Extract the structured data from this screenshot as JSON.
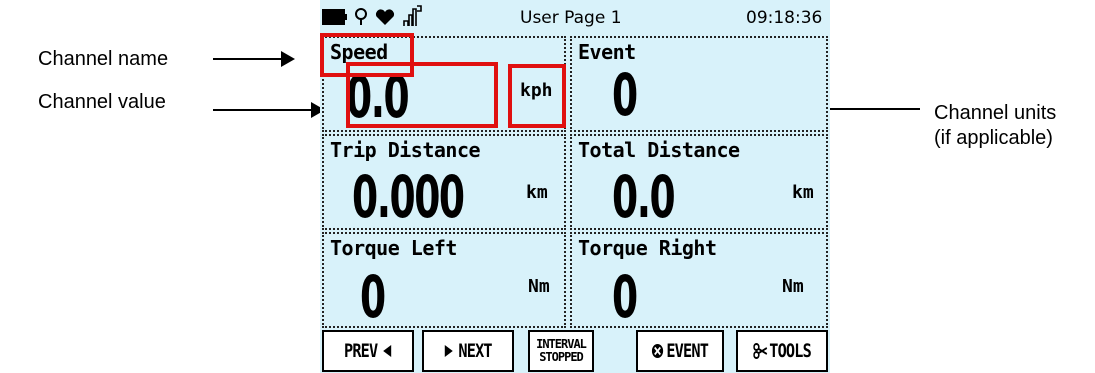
{
  "annotations": {
    "channel_name": "Channel name",
    "channel_value": "Channel value",
    "channel_units_line1": "Channel units",
    "channel_units_line2": "(if applicable)"
  },
  "status_bar": {
    "icons": [
      "battery-icon",
      "location-pin-icon",
      "heart-icon",
      "signal-icon"
    ],
    "page_title": "User Page 1",
    "time": "09:18:36"
  },
  "tiles": [
    {
      "name": "Speed",
      "value": "0.0",
      "unit": "kph"
    },
    {
      "name": "Event",
      "value": "0",
      "unit": ""
    },
    {
      "name": "Trip Distance",
      "value": "0.000",
      "unit": "km"
    },
    {
      "name": "Total Distance",
      "value": "0.0",
      "unit": "km"
    },
    {
      "name": "Torque Left",
      "value": "0",
      "unit": "Nm"
    },
    {
      "name": "Torque Right",
      "value": "0",
      "unit": "Nm"
    }
  ],
  "softkeys": {
    "prev": "PREV",
    "next": "NEXT",
    "interval_line1": "INTERVAL",
    "interval_line2": "STOPPED",
    "event": "EVENT",
    "tools": "TOOLS"
  },
  "colors": {
    "screen_bg": "#d8f2fa",
    "highlight": "#e01010"
  }
}
